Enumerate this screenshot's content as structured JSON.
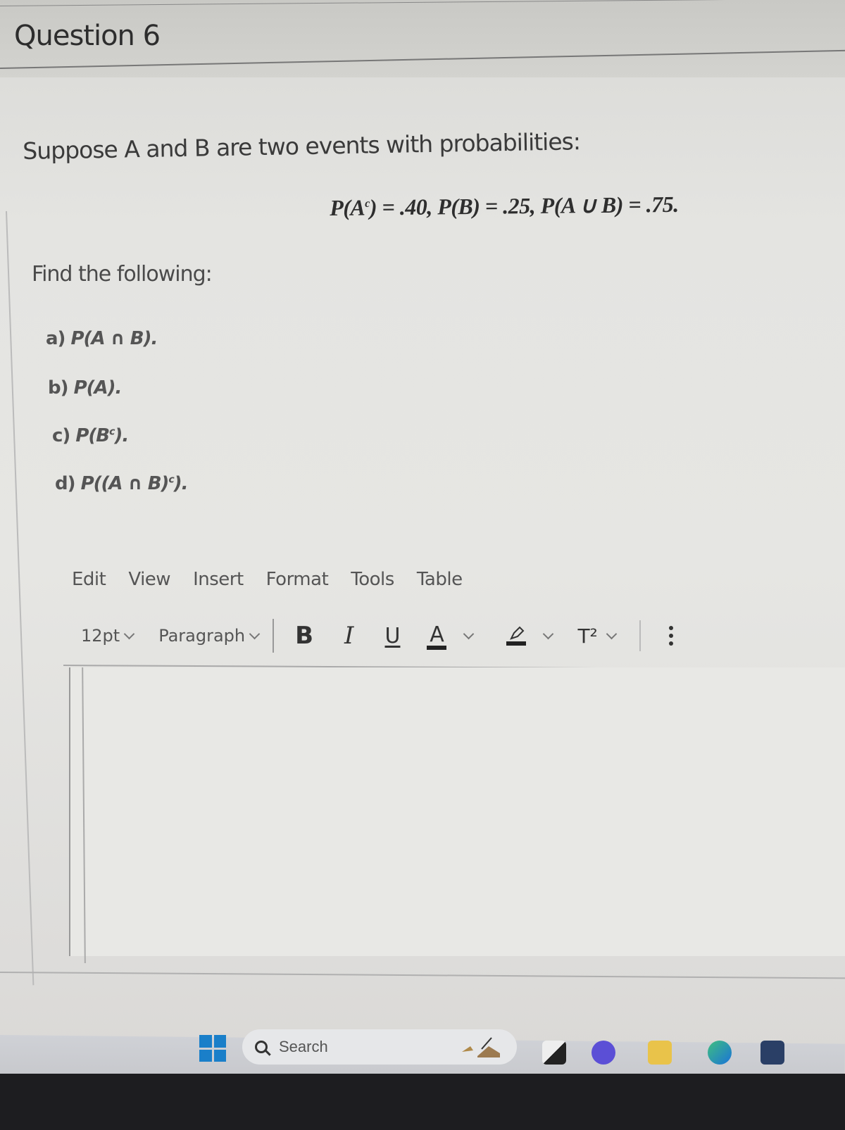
{
  "question": {
    "title": "Question 6",
    "intro": "Suppose A and B are two events with probabilities:",
    "formula": {
      "parts": [
        "P(A",
        "c",
        ") = .40,  P(B) = .25,  P(A ∪ B) = .75."
      ]
    },
    "find_label": "Find the following:",
    "parts": [
      {
        "label": "a)",
        "expr": "P(A ∩ B)."
      },
      {
        "label": "b)",
        "expr": "P(A)."
      },
      {
        "label": "c)",
        "expr_pre": "P(B",
        "sup": "c",
        "expr_post": ")."
      },
      {
        "label": "d)",
        "expr_pre": "P((A ∩ B)",
        "sup": "c",
        "expr_post": ")."
      }
    ]
  },
  "editor": {
    "menu": [
      "Edit",
      "View",
      "Insert",
      "Format",
      "Tools",
      "Table"
    ],
    "toolbar": {
      "font_size": "12pt",
      "block_format": "Paragraph",
      "bold": "B",
      "italic": "I",
      "underline": "U",
      "text_color": "A",
      "superscript": "T²"
    },
    "content": ""
  },
  "taskbar": {
    "search_placeholder": "Search",
    "apps": [
      "task-view",
      "meet",
      "file-explorer",
      "edge",
      "store"
    ]
  }
}
